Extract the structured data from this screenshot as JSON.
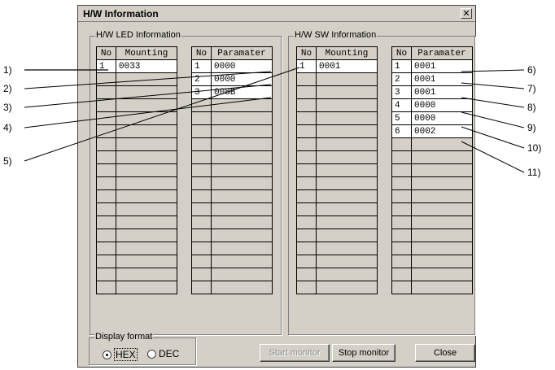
{
  "dialog": {
    "title": "H/W Information",
    "close_glyph": "✕"
  },
  "led": {
    "label": "H/W LED Information",
    "mount_headers": [
      "No",
      "Mounting"
    ],
    "mount_rows": [
      [
        "1",
        "0033"
      ]
    ],
    "param_headers": [
      "No",
      "Paramater"
    ],
    "param_rows": [
      [
        "1",
        "0000"
      ],
      [
        "2",
        "0000"
      ],
      [
        "3",
        "008B"
      ]
    ]
  },
  "sw": {
    "label": "H/W SW Information",
    "mount_headers": [
      "No",
      "Mounting"
    ],
    "mount_rows": [
      [
        "1",
        "0001"
      ]
    ],
    "param_headers": [
      "No",
      "Paramater"
    ],
    "param_rows": [
      [
        "1",
        "0001"
      ],
      [
        "2",
        "0001"
      ],
      [
        "3",
        "0001"
      ],
      [
        "4",
        "0000"
      ],
      [
        "5",
        "0000"
      ],
      [
        "6",
        "0002"
      ]
    ]
  },
  "display_format": {
    "label": "Display format",
    "hex_label": "HEX",
    "dec_label": "DEC",
    "selected": "HEX"
  },
  "buttons": {
    "start_monitor": "Start monitor",
    "stop_monitor": "Stop monitor",
    "close": "Close"
  },
  "callouts": {
    "left": [
      "1)",
      "2)",
      "3)",
      "4)",
      "5)"
    ],
    "right": [
      "6)",
      "7)",
      "8)",
      "9)",
      "10)",
      "11)"
    ]
  }
}
